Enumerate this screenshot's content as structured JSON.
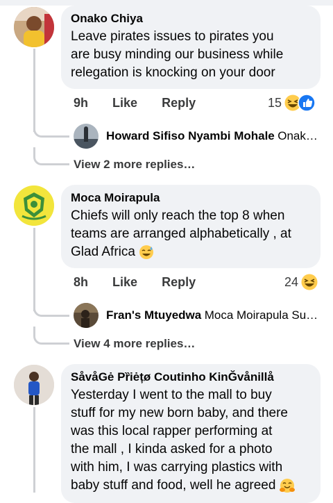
{
  "comments": [
    {
      "author": "Onako Chiya",
      "text_lines": [
        "Leave pirates issues to pirates you",
        "are busy minding our business while",
        "relegation is knocking on your door"
      ],
      "time": "9h",
      "like": "Like",
      "reply": "Reply",
      "reaction_count": "15",
      "reactions": [
        "laugh-emoji",
        "like-icon"
      ],
      "reply_preview": {
        "author": "Howard Sifiso Nyambi Mohale",
        "snippet": "Onak…"
      },
      "more_replies": "View 2 more replies…"
    },
    {
      "author": "Moca Moirapula",
      "text_lines": [
        "Chiefs will only reach the top 8 when",
        "teams are arranged alphabetically , at",
        "Glad Africa"
      ],
      "text_emoji": "sweat-smile-emoji",
      "time": "8h",
      "like": "Like",
      "reply": "Reply",
      "reaction_count": "24",
      "reactions": [
        "laugh-emoji"
      ],
      "reply_preview": {
        "author": "Fran's Mtuyedwa",
        "snippet": "Moca Moirapula Su…"
      },
      "more_replies": "View 4 more replies…"
    },
    {
      "author": "SåvåGė Pȑiėțø Coutinho KinĞvånillå",
      "text_lines": [
        "Yesterday I went to the mall to buy",
        "stuff for my new born baby, and there",
        "was this local rapper performing at",
        "the mall , I kinda asked for a photo",
        "with him, I was carrying plastics with",
        "baby stuff and food, well he agreed"
      ],
      "text_emoji": "hugging-emoji"
    }
  ],
  "colors": {
    "bubble": "#f0f2f5",
    "line": "#ced0d4",
    "like_blue": "#1877f2",
    "emoji_yellow": "#ffcc4d"
  }
}
